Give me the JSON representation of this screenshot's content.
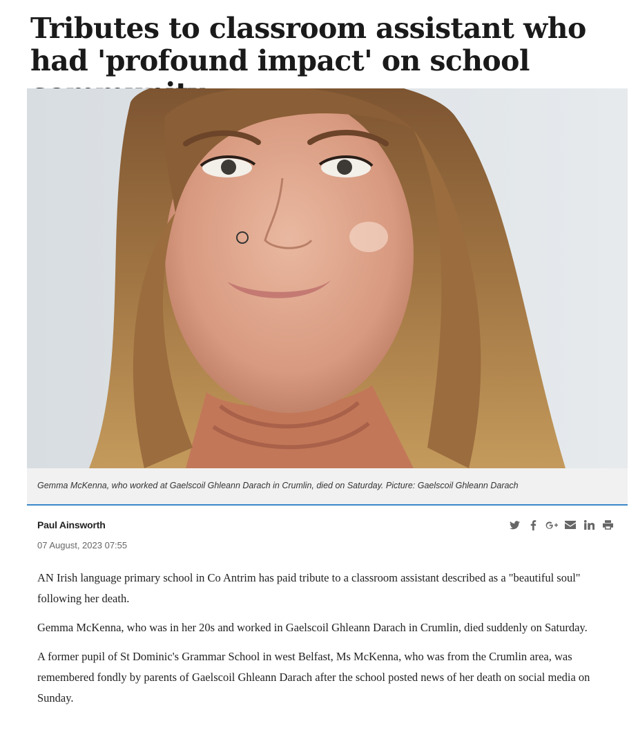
{
  "article": {
    "headline": "Tributes to classroom assistant who had 'profound impact' on school community",
    "photo": {
      "alt": "Gemma McKenna"
    },
    "caption": "Gemma McKenna, who worked at Gaelscoil Ghleann Darach in Crumlin, died on Saturday. Picture: Gaelscoil Ghleann Darach",
    "author": "Paul Ainsworth",
    "date": "07 August, 2023 07:55",
    "share_icons": [
      "twitter-icon",
      "facebook-icon",
      "google-plus-icon",
      "email-icon",
      "linkedin-icon",
      "print-icon"
    ],
    "paragraphs": [
      "AN Irish language primary school in Co Antrim has paid tribute to a classroom assistant described as a \"beautiful soul\" following her death.",
      "Gemma McKenna, who was in her 20s and worked in Gaelscoil Ghleann Darach in Crumlin, died suddenly on Saturday.",
      "A former pupil of St Dominic's Grammar School in west Belfast, Ms McKenna, who was from the Crumlin area, was remembered fondly by parents of Gaelscoil Ghleann Darach after the school posted news of her death on social media on Sunday."
    ]
  },
  "colors": {
    "accent": "#3a86c8",
    "caption_bg": "#f1f1f1",
    "icon": "#666666"
  }
}
